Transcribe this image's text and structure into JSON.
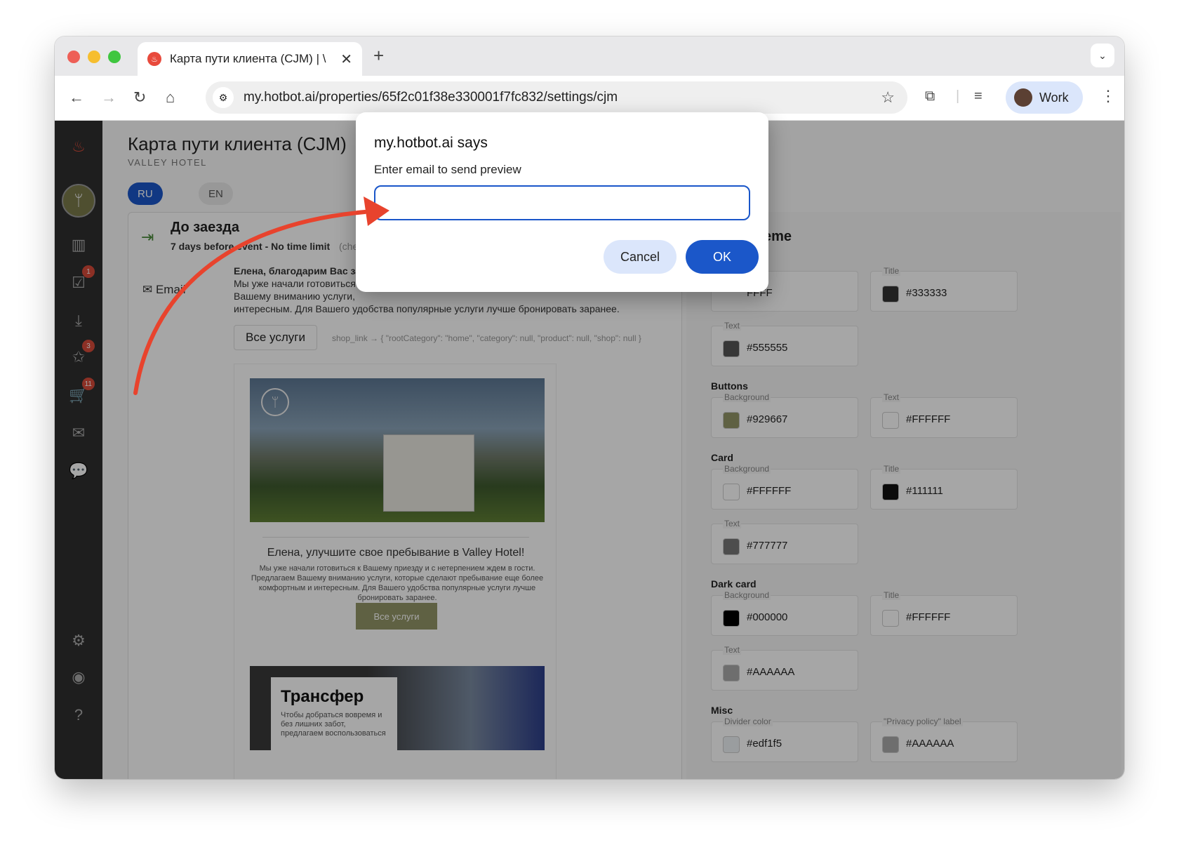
{
  "browser": {
    "tab_title": "Карта пути клиента (CJM) | \\",
    "url": "my.hotbot.ai/properties/65f2c01f38e330001f7fc832/settings/cjm",
    "profile_label": "Work",
    "new_tab": "+",
    "close_tab": "✕"
  },
  "page": {
    "title": "Карта пути клиента (CJM)",
    "subtitle": "VALLEY HOTEL",
    "lang_ru": "RU",
    "lang_en": "EN"
  },
  "sidebar": {
    "badges": [
      "1",
      "3",
      "11"
    ]
  },
  "stage": {
    "title": "До заезда",
    "subtitle": "7 days before event - No time limit",
    "chip": "(che",
    "channel": "Email",
    "email_greeting": "Елена, благодарим Вас за",
    "email_body_1": "Мы уже начали готовиться",
    "email_body_2": "Вашему вниманию услуги,",
    "email_body_3": "интересным. Для Вашего удобства популярные услуги лучше бронировать заранее.",
    "button_label": "Все услуги",
    "shop_link": "shop_link → { \"rootCategory\": \"home\", \"category\": null, \"product\": null, \"shop\": null }"
  },
  "preview": {
    "heading": "Елена, улучшите свое пребывание в Valley Hotel!",
    "body": "Мы уже начали готовиться к Вашему приезду и с нетерпением ждем в гости. Предлагаем Вашему вниманию услуги, которые сделают пребывание еще более комфортным и интересным. Для Вашего удобства популярные услуги лучше бронировать заранее.",
    "button": "Все услуги",
    "card_title": "Трансфер",
    "card_text": "Чтобы добраться вовремя и без лишних забот, предлагаем воспользоваться"
  },
  "theme": {
    "heading": "eme",
    "top": {
      "bg_label": "round",
      "bg_value": "FFFF",
      "title_label": "Title",
      "title_value": "#333333",
      "title_color": "#333333",
      "text_label": "Text",
      "text_value": "#555555",
      "text_color": "#555555"
    },
    "buttons": {
      "label": "Buttons",
      "bg_label": "Background",
      "bg_value": "#929667",
      "bg_color": "#929667",
      "text_label": "Text",
      "text_value": "#FFFFFF",
      "text_color": "#FFFFFF"
    },
    "card": {
      "label": "Card",
      "bg_label": "Background",
      "bg_value": "#FFFFFF",
      "bg_color": "#FFFFFF",
      "title_label": "Title",
      "title_value": "#111111",
      "title_color": "#111111",
      "text_label": "Text",
      "text_value": "#777777",
      "text_color": "#777777"
    },
    "dark_card": {
      "label": "Dark card",
      "bg_label": "Background",
      "bg_value": "#000000",
      "bg_color": "#000000",
      "title_label": "Title",
      "title_value": "#FFFFFF",
      "title_color": "#FFFFFF",
      "text_label": "Text",
      "text_value": "#AAAAAA",
      "text_color": "#AAAAAA"
    },
    "misc": {
      "label": "Misc",
      "divider_label": "Divider color",
      "divider_value": "#edf1f5",
      "divider_color": "#edf1f5",
      "privacy_label": "\"Privacy policy\" label",
      "privacy_value": "#AAAAAA",
      "privacy_color": "#AAAAAA"
    }
  },
  "dialog": {
    "title": "my.hotbot.ai says",
    "message": "Enter email to send preview",
    "input_value": "",
    "cancel": "Cancel",
    "ok": "OK"
  },
  "colors": {
    "accent_blue": "#1b57c9",
    "annotation_arrow": "#e8432d"
  }
}
